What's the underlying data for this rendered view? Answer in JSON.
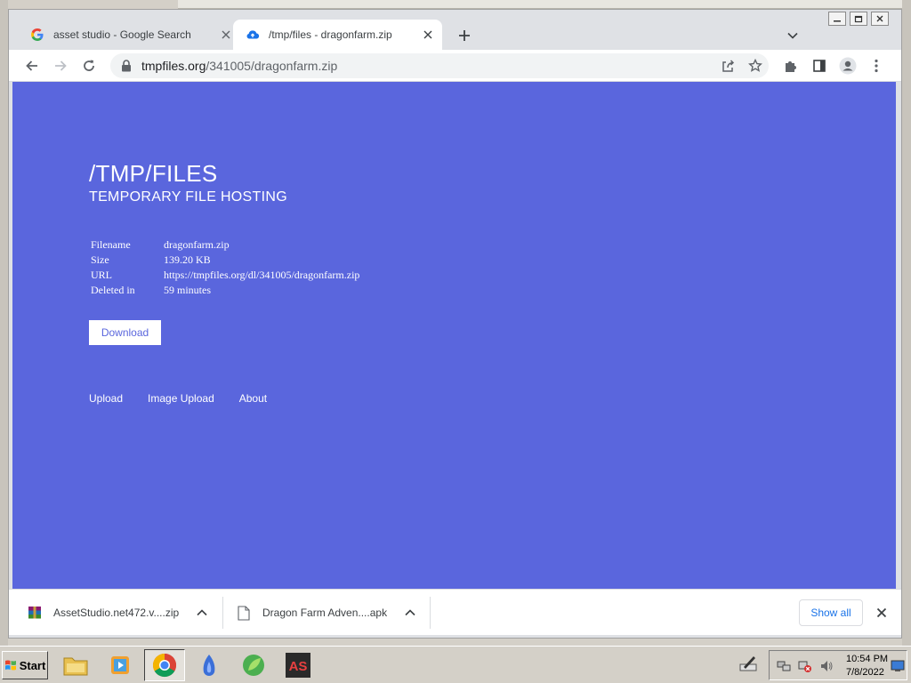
{
  "browser": {
    "tabs": [
      {
        "title": "asset studio - Google Search",
        "favicon": "google-icon"
      },
      {
        "title": "/tmp/files - dragonfarm.zip",
        "favicon": "cloud-upload-icon",
        "active": true
      }
    ],
    "address": {
      "domain": "tmpfiles.org",
      "path": "/341005/dragonfarm.zip"
    }
  },
  "page": {
    "title": "/TMP/FILES",
    "subtitle": "TEMPORARY FILE HOSTING",
    "file_info": [
      {
        "label": "Filename",
        "value": "dragonfarm.zip"
      },
      {
        "label": "Size",
        "value": "139.20 KB"
      },
      {
        "label": "URL",
        "value": "https://tmpfiles.org/dl/341005/dragonfarm.zip"
      },
      {
        "label": "Deleted in",
        "value": "59 minutes"
      }
    ],
    "download_label": "Download",
    "footer_links": [
      "Upload",
      "Image Upload",
      "About"
    ],
    "colors": {
      "background": "#5a66dd",
      "text": "#ffffff"
    }
  },
  "downloads": {
    "items": [
      {
        "name": "AssetStudio.net472.v....zip",
        "icon": "winrar-archive-icon"
      },
      {
        "name": "Dragon Farm Adven....apk",
        "icon": "file-icon"
      }
    ],
    "show_all_label": "Show all"
  },
  "taskbar": {
    "start_label": "Start",
    "clock_time": "10:54 PM",
    "clock_date": "7/8/2022"
  }
}
